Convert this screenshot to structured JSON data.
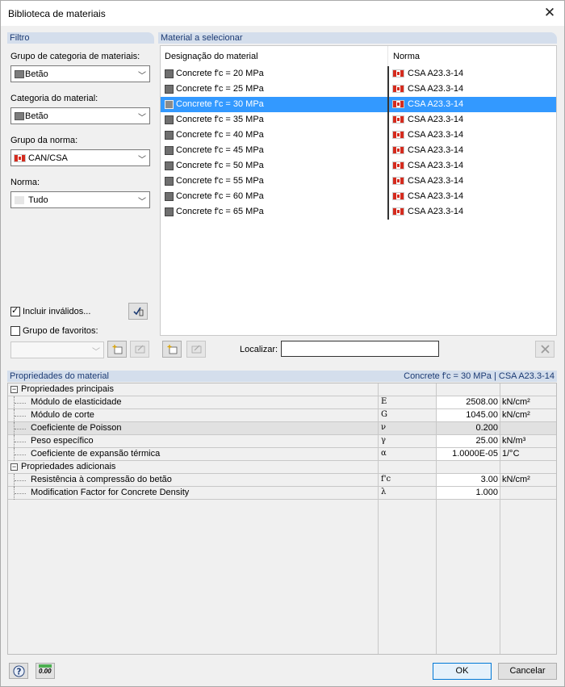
{
  "window": {
    "title": "Biblioteca de materiais"
  },
  "filter": {
    "header": "Filtro",
    "category_group_label": "Grupo de categoria de materiais:",
    "category_group_value": "Betão",
    "category_label": "Categoria do material:",
    "category_value": "Betão",
    "norm_group_label": "Grupo da norma:",
    "norm_group_value": "CAN/CSA",
    "norm_label": "Norma:",
    "norm_value": "Tudo",
    "include_invalid_label": "Incluir inválidos...",
    "include_invalid_checked": true,
    "favorites_label": "Grupo de favoritos:",
    "favorites_checked": false
  },
  "materials": {
    "header": "Material a selecionar",
    "col_name": "Designação do material",
    "col_norm": "Norma",
    "selected_index": 2,
    "rows": [
      {
        "name": "Concrete f'c = 20 MPa",
        "norm": "CSA A23.3-14"
      },
      {
        "name": "Concrete f'c = 25 MPa",
        "norm": "CSA A23.3-14"
      },
      {
        "name": "Concrete f'c = 30 MPa",
        "norm": "CSA A23.3-14"
      },
      {
        "name": "Concrete f'c = 35 MPa",
        "norm": "CSA A23.3-14"
      },
      {
        "name": "Concrete f'c = 40 MPa",
        "norm": "CSA A23.3-14"
      },
      {
        "name": "Concrete f'c = 45 MPa",
        "norm": "CSA A23.3-14"
      },
      {
        "name": "Concrete f'c = 50 MPa",
        "norm": "CSA A23.3-14"
      },
      {
        "name": "Concrete f'c = 55 MPa",
        "norm": "CSA A23.3-14"
      },
      {
        "name": "Concrete f'c = 60 MPa",
        "norm": "CSA A23.3-14"
      },
      {
        "name": "Concrete f'c = 65 MPa",
        "norm": "CSA A23.3-14"
      }
    ],
    "find_label": "Localizar:",
    "find_value": ""
  },
  "properties": {
    "header": "Propriedades do material",
    "selection_summary": "Concrete f'c = 30 MPa  |  CSA A23.3-14",
    "groups": [
      {
        "name": "Propriedades principais",
        "items": [
          {
            "name": "Módulo de elasticidade",
            "symbol": "E",
            "value": "2508.00",
            "unit": "kN/cm²"
          },
          {
            "name": "Módulo de corte",
            "symbol": "G",
            "value": "1045.00",
            "unit": "kN/cm²"
          },
          {
            "name": "Coeficiente de Poisson",
            "symbol": "ν",
            "value": "0.200",
            "unit": ""
          },
          {
            "name": "Peso específico",
            "symbol": "γ",
            "value": "25.00",
            "unit": "kN/m³"
          },
          {
            "name": "Coeficiente de expansão térmica",
            "symbol": "α",
            "value": "1.0000E-05",
            "unit": "1/°C"
          }
        ]
      },
      {
        "name": "Propriedades adicionais",
        "items": [
          {
            "name": "Resistência à compressão do betão",
            "symbol": "f'c",
            "value": "3.00",
            "unit": "kN/cm²"
          },
          {
            "name": "Modification Factor for Concrete Density",
            "symbol": "λ",
            "value": "1.000",
            "unit": ""
          }
        ]
      }
    ]
  },
  "footer": {
    "ok_label": "OK",
    "cancel_label": "Cancelar",
    "units_icon_text": "0.00"
  }
}
